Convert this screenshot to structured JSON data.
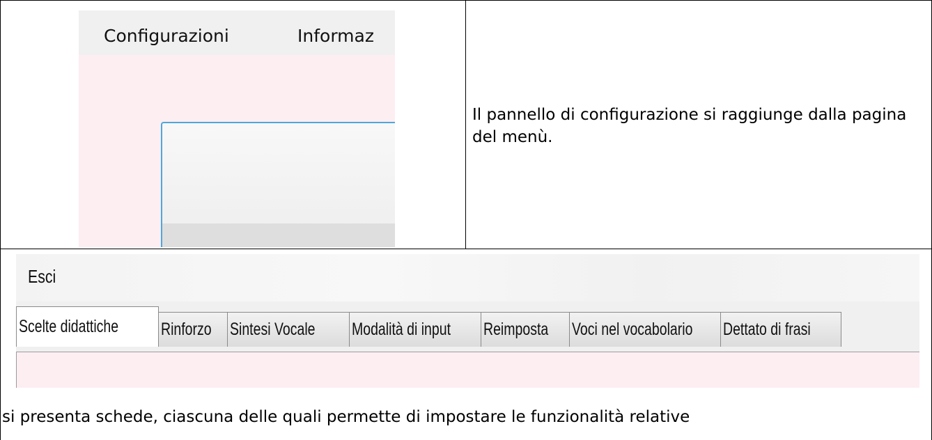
{
  "top_left_screenshot": {
    "menu_items": [
      "Configurazioni",
      "Informaz"
    ]
  },
  "description": "Il pannello di configurazione si raggiunge dalla pagina del menù.",
  "bottom_screenshot": {
    "exit_menu": "Esci",
    "tabs": [
      {
        "label": "Scelte didattiche",
        "active": true
      },
      {
        "label": "Rinforzo",
        "active": false
      },
      {
        "label": "Sintesi Vocale",
        "active": false
      },
      {
        "label": "Modalità di input",
        "active": false
      },
      {
        "label": "Reimposta",
        "active": false
      },
      {
        "label": "Voci nel vocabolario",
        "active": false
      },
      {
        "label": "Dettato di frasi",
        "active": false
      }
    ]
  },
  "bottom_text": "si presenta schede, ciascuna delle quali permette di impostare le funzionalità relative"
}
